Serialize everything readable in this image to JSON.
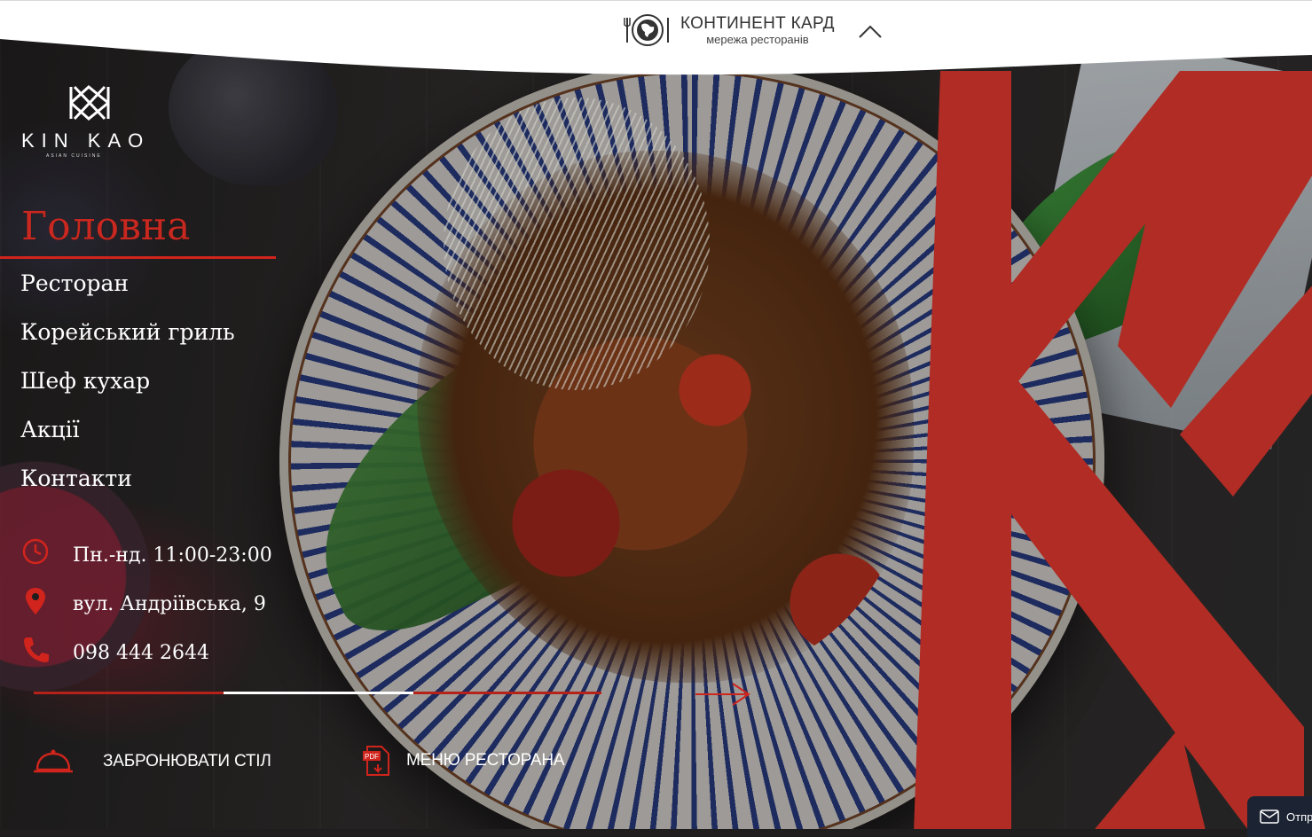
{
  "header": {
    "brand_title": "КОНТИНЕНТ КАРД",
    "brand_subtitle": "мережа ресторанів"
  },
  "logo": {
    "word": "KIN KAO",
    "tagline": "ASIAN CUISINE"
  },
  "nav": {
    "active": "Головна",
    "items": [
      "Ресторан",
      "Корейський гриль",
      "Шеф кухар",
      "Акції",
      "Контакти"
    ]
  },
  "info": {
    "hours": "Пн.-нд. 11:00-23:00",
    "address": "вул. Андріївська, 9",
    "phone": "098 444 2644"
  },
  "slider": {
    "slides_total": 3,
    "active_slide": 2
  },
  "actions": {
    "book_table": "ЗАБРОНЮВАТИ СТІЛ",
    "menu": "МЕНЮ РЕСТОРАНА",
    "menu_badge": "PDF"
  },
  "chat": {
    "label": "Отпр"
  },
  "colors": {
    "accent": "#d0241c",
    "topbar": "#ffffff",
    "chat_bg": "#1c2433"
  }
}
